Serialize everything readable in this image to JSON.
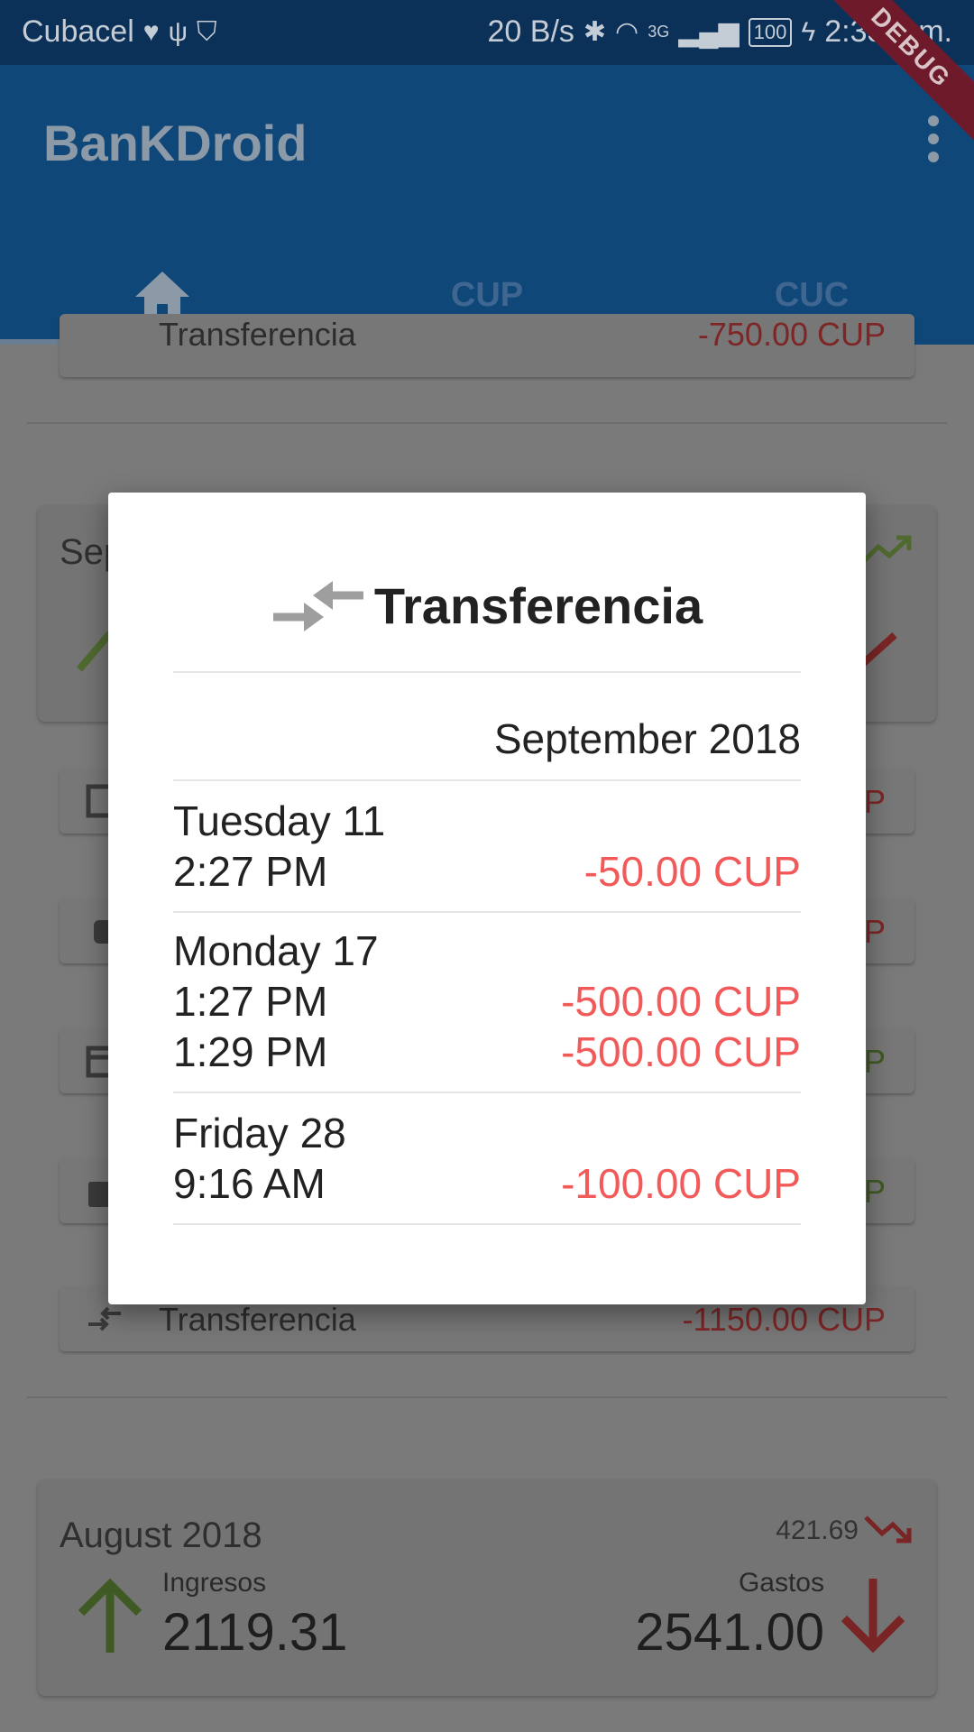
{
  "status_bar": {
    "carrier": "Cubacel",
    "speed": "20 B/s",
    "network": "3G",
    "battery": "100",
    "time": "2:33 p.m."
  },
  "app_bar": {
    "title": "BanKDroid",
    "debug_banner": "DEBUG",
    "tabs": [
      {
        "icon": "home-icon",
        "label": ""
      },
      {
        "label": "CUP"
      },
      {
        "label": "CUC"
      }
    ]
  },
  "background": {
    "top_row": {
      "label": "Transferencia",
      "value": "-750.00 CUP"
    },
    "september_card_title": "Sep",
    "visible_value_fragments": [
      "P",
      "P",
      "P",
      "P"
    ],
    "bottom_row": {
      "label": "Transferencia",
      "value": "-1150.00 CUP"
    },
    "august_card": {
      "title": "August 2018",
      "balance": "421.69",
      "income_label": "Ingresos",
      "income_value": "2119.31",
      "expense_label": "Gastos",
      "expense_value": "2541.00"
    }
  },
  "dialog": {
    "title": "Transferencia",
    "month": "September 2018",
    "groups": [
      {
        "day": "Tuesday 11",
        "transactions": [
          {
            "time": "2:27 PM",
            "amount": "-50.00 CUP"
          }
        ]
      },
      {
        "day": "Monday 17",
        "transactions": [
          {
            "time": "1:27 PM",
            "amount": "-500.00 CUP"
          },
          {
            "time": "1:29 PM",
            "amount": "-500.00 CUP"
          }
        ]
      },
      {
        "day": "Friday 28",
        "transactions": [
          {
            "time": "9:16 AM",
            "amount": "-100.00 CUP"
          }
        ]
      }
    ]
  },
  "colors": {
    "primary": "#104779",
    "negative": "#f25a5a",
    "income": "#5b8a2c",
    "expense": "#8a2a2a"
  }
}
